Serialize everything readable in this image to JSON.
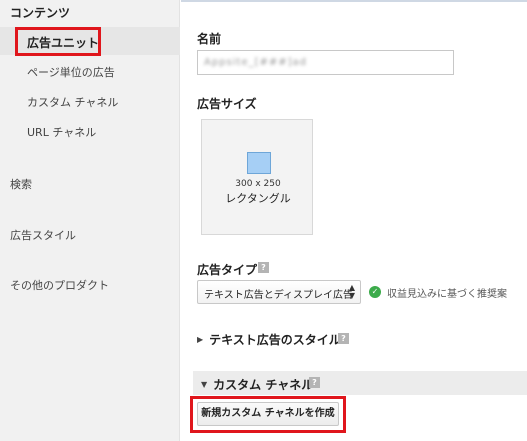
{
  "sidebar": {
    "heading": "コンテンツ",
    "items": [
      {
        "label": "広告ユニット",
        "active": true
      },
      {
        "label": "ページ単位の広告"
      },
      {
        "label": "カスタム チャネル"
      },
      {
        "label": "URL チャネル"
      }
    ],
    "sections": [
      "検索",
      "広告スタイル",
      "その他のプロダクト"
    ]
  },
  "main": {
    "name_label": "名前",
    "name_value": "Appsite_[###]ad",
    "ad_size_label": "広告サイズ",
    "ad_size_card": {
      "dimensions": "300 x 250",
      "name": "レクタングル"
    },
    "ad_type_label": "広告タイプ",
    "ad_type_selected": "テキスト広告とディスプレイ広告",
    "ad_type_hint": "収益見込みに基づく推奨案",
    "text_style_label": "テキスト広告のスタイル",
    "custom_channel_label": "カスタム チャネル",
    "create_channel_button": "新規カスタム チャネルを作成"
  },
  "icons": {
    "help": "help-icon",
    "check": "check-circle-icon",
    "expand": "triangle-right-icon",
    "collapse": "triangle-down-icon",
    "select_arrows": "select-arrows-icon"
  },
  "colors": {
    "highlight_box": "#e0161c",
    "size_square": "#a6cff5",
    "check_green": "#3cab4b"
  }
}
